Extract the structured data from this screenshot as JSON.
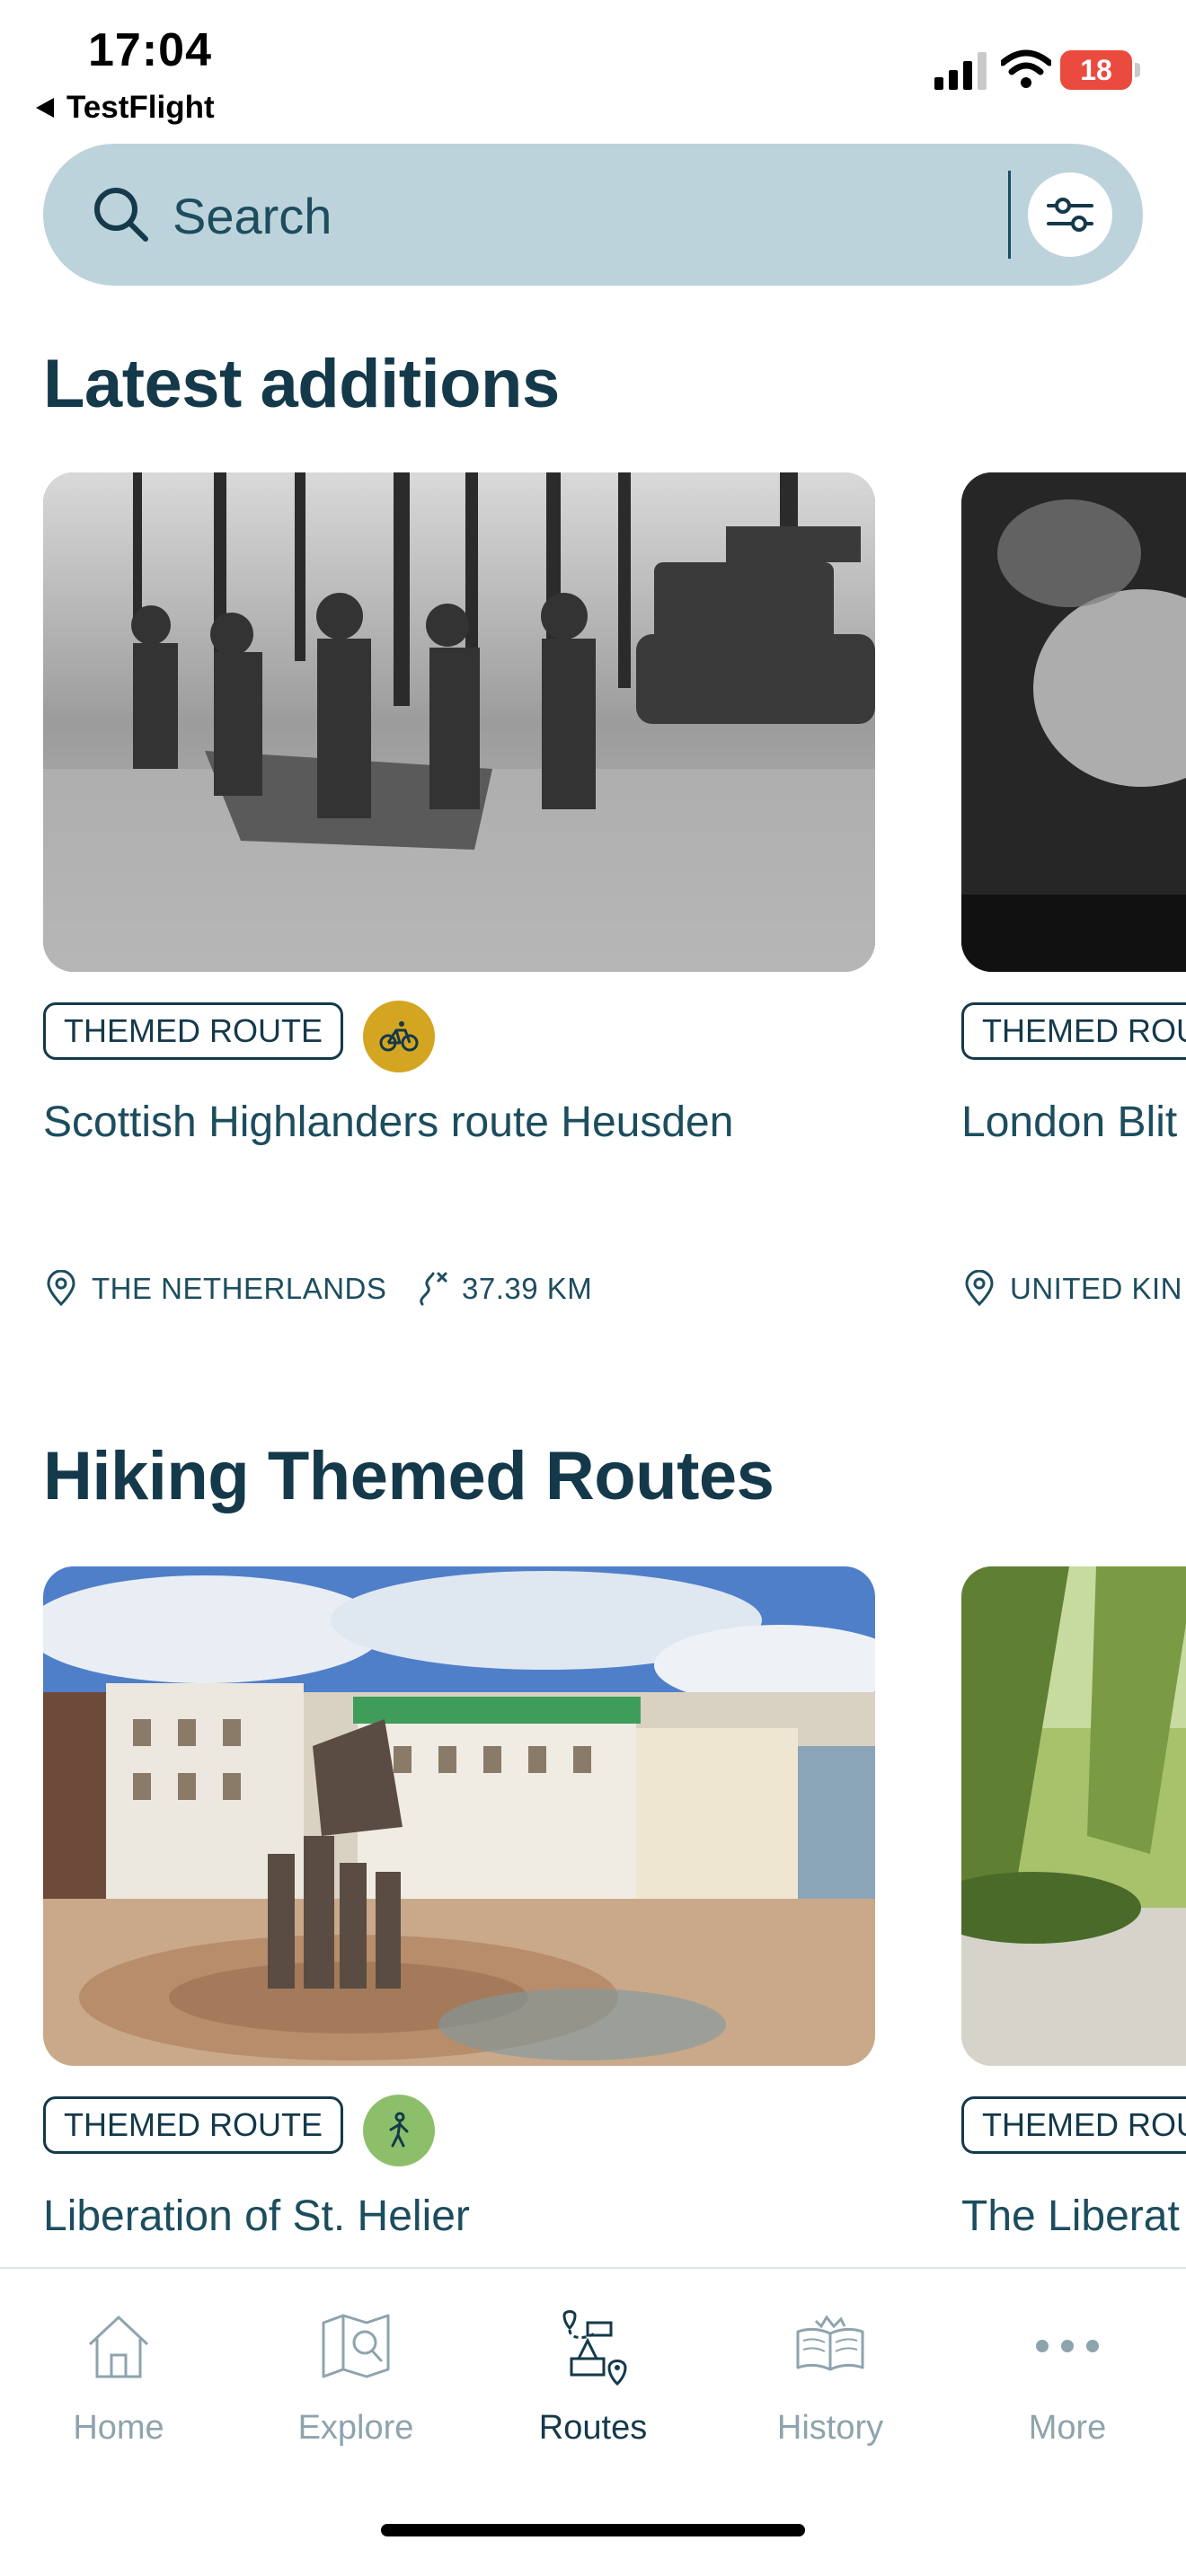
{
  "status_bar": {
    "time": "17:04",
    "back_app": "TestFlight",
    "battery": "18"
  },
  "search": {
    "placeholder": "Search",
    "icon": "search-icon",
    "filter_icon": "sliders-icon"
  },
  "sections": [
    {
      "title": "Latest additions",
      "cards": [
        {
          "badge": "THEMED ROUTE",
          "mode_icon": "bicycle-icon",
          "mode_color": "#d4a520",
          "title": "Scottish Highlanders route Heusden",
          "location": "THE NETHERLANDS",
          "distance": "37.39 KM"
        },
        {
          "badge": "THEMED ROU",
          "title": "London Blit",
          "location": "UNITED KIN"
        }
      ]
    },
    {
      "title": "Hiking Themed Routes",
      "cards": [
        {
          "badge": "THEMED ROUTE",
          "mode_icon": "walking-icon",
          "mode_color": "#8dbf6a",
          "title": "Liberation of St. Helier"
        },
        {
          "badge": "THEMED ROU",
          "title": "The Liberat"
        }
      ]
    }
  ],
  "tab_bar": {
    "items": [
      {
        "label": "Home",
        "icon": "home-icon",
        "active": false
      },
      {
        "label": "Explore",
        "icon": "map-search-icon",
        "active": false
      },
      {
        "label": "Routes",
        "icon": "route-icon",
        "active": true
      },
      {
        "label": "History",
        "icon": "open-book-icon",
        "active": false
      },
      {
        "label": "More",
        "icon": "more-dots-icon",
        "active": false
      }
    ]
  },
  "colors": {
    "primary": "#14394a",
    "search_bg": "#bdd3db",
    "inactive_tab": "#8ea4ad",
    "battery_low": "#eb4b3f"
  }
}
